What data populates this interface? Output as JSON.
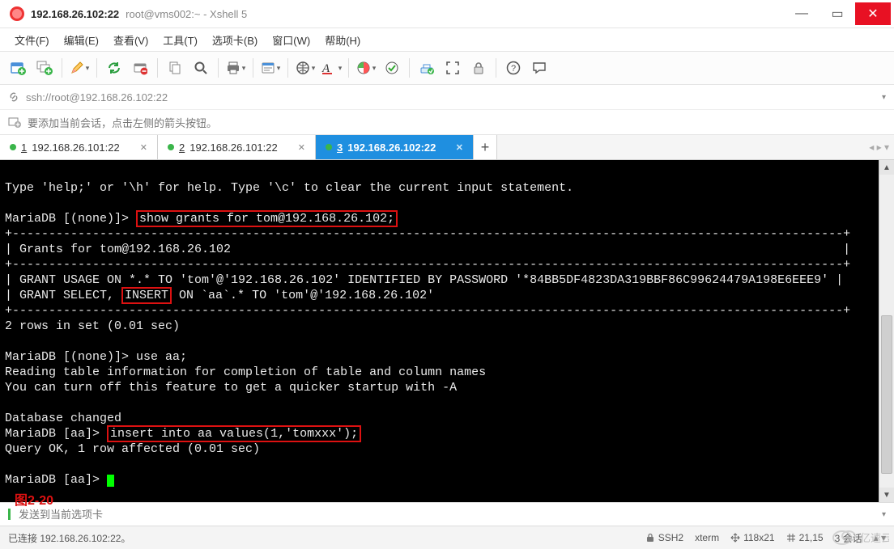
{
  "title": {
    "host": "192.168.26.102:22",
    "rest": "root@vms002:~ - Xshell 5"
  },
  "menu": [
    "文件(F)",
    "编辑(E)",
    "查看(V)",
    "工具(T)",
    "选项卡(B)",
    "窗口(W)",
    "帮助(H)"
  ],
  "address": "ssh://root@192.168.26.102:22",
  "hint": "要添加当前会话，点击左侧的箭头按钮。",
  "tabs": [
    {
      "n": "1",
      "label": "192.168.26.101:22",
      "active": false
    },
    {
      "n": "2",
      "label": "192.168.26.101:22",
      "active": false
    },
    {
      "n": "3",
      "label": "192.168.26.102:22",
      "active": true
    }
  ],
  "terminal": {
    "l1": "Type 'help;' or '\\h' for help. Type '\\c' to clear the current input statement.",
    "l2": "MariaDB [(none)]> ",
    "hi1": "show grants for tom@192.168.26.102;",
    "l3": "+------------------------------------------------------------------------------------------------------------------+",
    "l4": "| Grants for tom@192.168.26.102                                                                                    |",
    "l5": "+------------------------------------------------------------------------------------------------------------------+",
    "l6a": "| GRANT USAGE ON *.* TO 'tom'@'192.168.26.102' IDENTIFIED BY PASSWORD '*84BB5DF4823DA319BBF86C99624479A198E6EEE9' |",
    "l7a": "| GRANT SELECT, ",
    "hi2": "INSERT",
    "l7b": " ON `aa`.* TO 'tom'@'192.168.26.102'                                                               |",
    "l8": "+------------------------------------------------------------------------------------------------------------------+",
    "l9": "2 rows in set (0.01 sec)",
    "l10": "MariaDB [(none)]> use aa;",
    "l11": "Reading table information for completion of table and column names",
    "l12": "You can turn off this feature to get a quicker startup with -A",
    "l13": "Database changed",
    "l14": "MariaDB [aa]> ",
    "hi3": "insert into aa values(1,'tomxxx');",
    "l15": "Query OK, 1 row affected (0.01 sec)",
    "l16": "MariaDB [aa]> "
  },
  "figure_label": "图2-20",
  "footer_placeholder": "发送到当前选项卡",
  "status": {
    "conn": "已连接 192.168.26.102:22。",
    "proto": "SSH2",
    "term": "xterm",
    "size": "118x21",
    "pos": "21,15",
    "sess": "3 会话"
  },
  "watermark": "亿速云",
  "icons": {
    "lock": "lock-icon",
    "add": "plus-icon"
  }
}
